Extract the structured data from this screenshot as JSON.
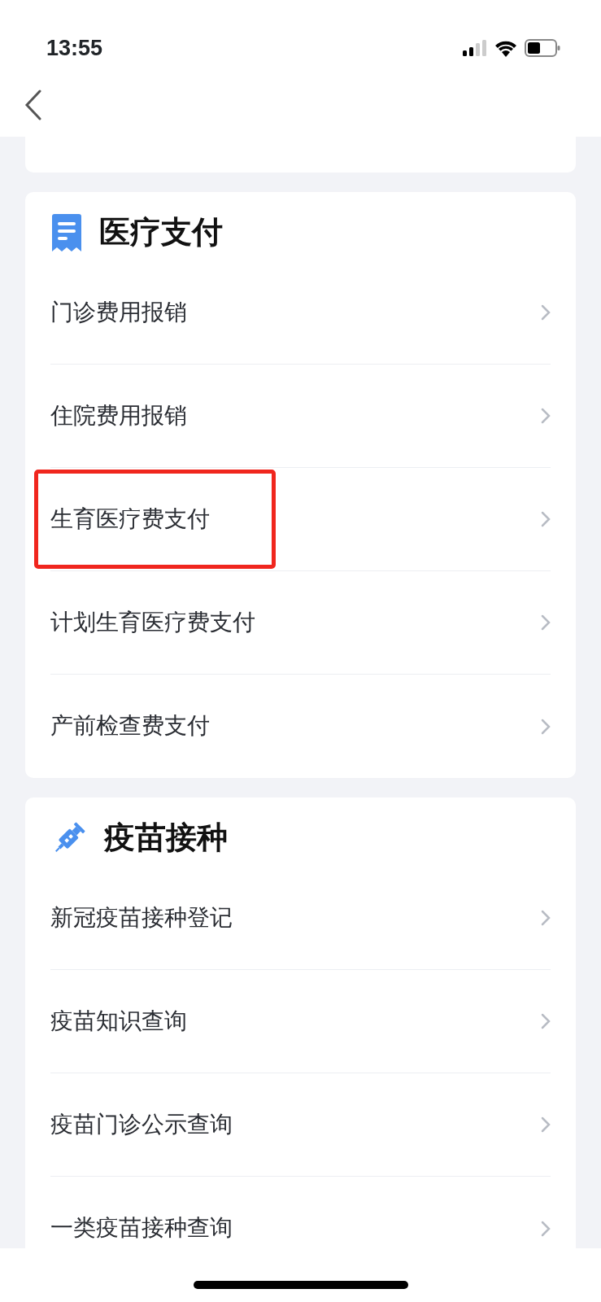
{
  "status_bar": {
    "time": "13:55"
  },
  "sections": [
    {
      "title": "医疗支付",
      "items": [
        {
          "label": "门诊费用报销",
          "highlighted": false
        },
        {
          "label": "住院费用报销",
          "highlighted": false
        },
        {
          "label": "生育医疗费支付",
          "highlighted": true
        },
        {
          "label": "计划生育医疗费支付",
          "highlighted": false
        },
        {
          "label": "产前检查费支付",
          "highlighted": false
        }
      ]
    },
    {
      "title": "疫苗接种",
      "items": [
        {
          "label": "新冠疫苗接种登记",
          "highlighted": false
        },
        {
          "label": "疫苗知识查询",
          "highlighted": false
        },
        {
          "label": "疫苗门诊公示查询",
          "highlighted": false
        },
        {
          "label": "一类疫苗接种查询",
          "highlighted": false
        }
      ]
    }
  ]
}
